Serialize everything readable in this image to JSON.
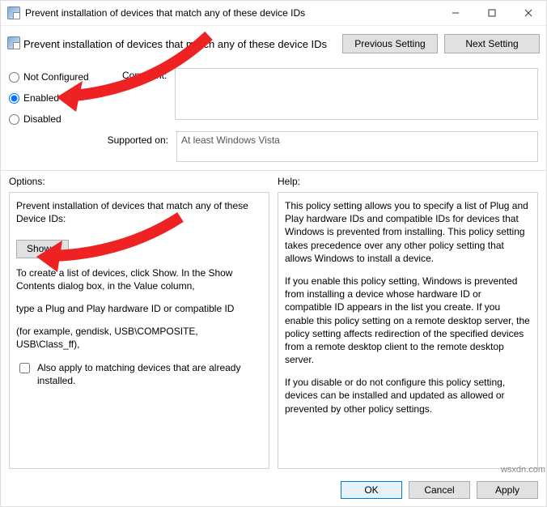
{
  "window": {
    "title": "Prevent installation of devices that match any of these device IDs"
  },
  "header": {
    "policy_title": "Prevent installation of devices that match any of these device IDs",
    "previous": "Previous Setting",
    "next": "Next Setting"
  },
  "state": {
    "not_configured": "Not Configured",
    "enabled": "Enabled",
    "disabled": "Disabled",
    "selected": "enabled",
    "comment_label": "Comment:",
    "comment_value": "",
    "supported_label": "Supported on:",
    "supported_value": "At least Windows Vista"
  },
  "labels": {
    "options": "Options:",
    "help": "Help:"
  },
  "options": {
    "intro": "Prevent installation of devices that match any of these Device IDs:",
    "show_btn": "Show...",
    "create_list": "To create a list of devices, click Show. In the Show Contents dialog box, in the Value column,",
    "type_id": "type a Plug and Play hardware ID or compatible ID",
    "example": "(for example, gendisk, USB\\COMPOSITE, USB\\Class_ff),",
    "also_apply": "Also apply to matching devices that are already installed.",
    "also_apply_checked": false
  },
  "help": {
    "p1": "This policy setting allows you to specify a list of Plug and Play hardware IDs and compatible IDs for devices that Windows is prevented from installing. This policy setting takes precedence over any other policy setting that allows Windows to install a device.",
    "p2": "If you enable this policy setting, Windows is prevented from installing a device whose hardware ID or compatible ID appears in the list you create. If you enable this policy setting on a remote desktop server, the policy setting affects redirection of the specified devices from a remote desktop client to the remote desktop server.",
    "p3": "If you disable or do not configure this policy setting, devices can be installed and updated as allowed or prevented by other policy settings."
  },
  "footer": {
    "ok": "OK",
    "cancel": "Cancel",
    "apply": "Apply"
  },
  "watermark": "wsxdn.com"
}
